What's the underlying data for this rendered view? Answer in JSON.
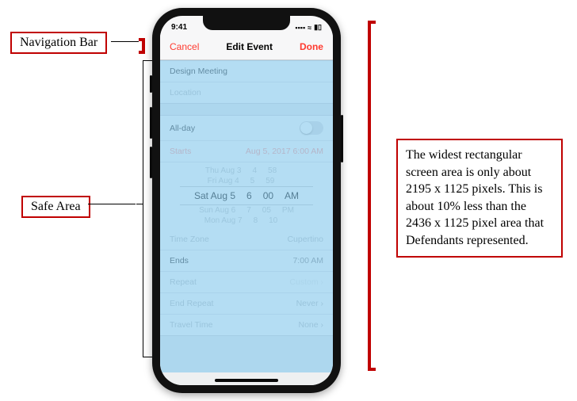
{
  "labels": {
    "navigation_bar": "Navigation Bar",
    "safe_area": "Safe Area"
  },
  "description": "The widest rectangular screen area is only about 2195 x 1125 pixels. This is about 10% less than the 2436 x 1125 pixel area that Defendants represented.",
  "status": {
    "time": "9:41",
    "signal": "▪▪▪▪",
    "wifi": "≈",
    "battery": "▮▯"
  },
  "nav": {
    "cancel": "Cancel",
    "title": "Edit Event",
    "done": "Done"
  },
  "event": {
    "title_field": "Design Meeting",
    "location_field": "Location"
  },
  "allday": {
    "label": "All-day"
  },
  "starts": {
    "label": "Starts",
    "value": "Aug 5, 2017   6:00 AM"
  },
  "picker": {
    "r1_date": "Thu Aug 3",
    "r1_h": "4",
    "r1_m": "58",
    "r2_date": "Fri Aug 4",
    "r2_h": "5",
    "r2_m": "59",
    "sel_date": "Sat Aug 5",
    "sel_h": "6",
    "sel_m": "00",
    "sel_ampm": "AM",
    "r4_date": "Sun Aug 6",
    "r4_h": "7",
    "r4_m": "05",
    "r4_ampm": "PM",
    "r5_date": "Mon Aug 7",
    "r5_h": "8",
    "r5_m": "10"
  },
  "timezone": {
    "label": "Time Zone",
    "value": "Cupertino"
  },
  "ends": {
    "label": "Ends",
    "value": "7:00 AM"
  },
  "repeat": {
    "label": "Repeat",
    "value": "Custom ›"
  },
  "endrepeat": {
    "label": "End Repeat",
    "value": "Never ›"
  },
  "travel": {
    "label": "Travel Time",
    "value": "None ›"
  }
}
